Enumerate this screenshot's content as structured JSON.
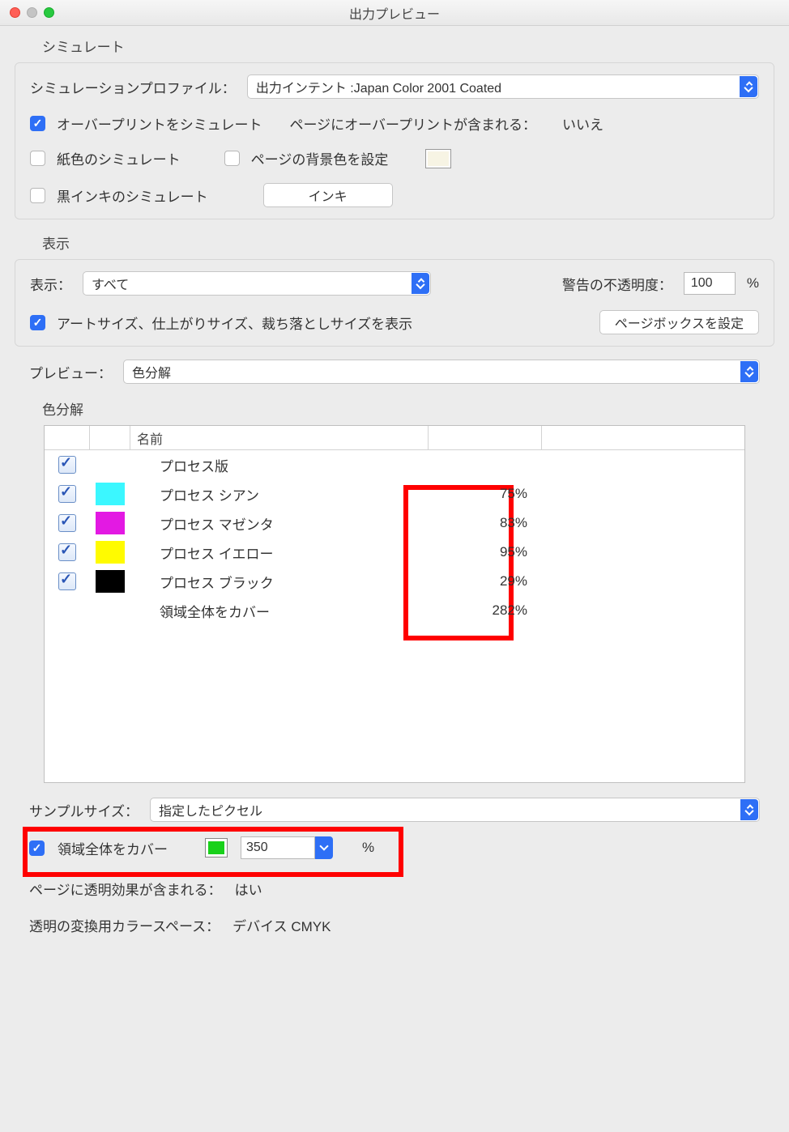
{
  "window": {
    "title": "出力プレビュー"
  },
  "simulate": {
    "section_label": "シミュレート",
    "profile_label": "シミュレーションプロファイル：",
    "profile_value": "出力インテント :Japan Color 2001 Coated",
    "overprint_checked": true,
    "overprint_label": "オーバープリントをシミュレート",
    "page_has_overprint_label": "ページにオーバープリントが含まれる：",
    "page_has_overprint_value": "いいえ",
    "paper_color_checked": false,
    "paper_color_label": "紙色のシミュレート",
    "set_bg_checked": false,
    "set_bg_label": "ページの背景色を設定",
    "black_ink_checked": false,
    "black_ink_label": "黒インキのシミュレート",
    "ink_button": "インキ"
  },
  "display": {
    "section_label": "表示",
    "show_label": "表示：",
    "show_value": "すべて",
    "opacity_label": "警告の不透明度：",
    "opacity_value": "100",
    "percent": "%",
    "artsize_checked": true,
    "artsize_label": "アートサイズ、仕上がりサイズ、裁ち落としサイズを表示",
    "pagebox_button": "ページボックスを設定"
  },
  "preview": {
    "label": "プレビュー：",
    "value": "色分解"
  },
  "separations": {
    "section_label": "色分解",
    "name_header": "名前",
    "rows": [
      {
        "name": "プロセス版",
        "value": "",
        "color": ""
      },
      {
        "name": "プロセス シアン",
        "value": "75%",
        "color": "#3bf7ff"
      },
      {
        "name": "プロセス マゼンタ",
        "value": "83%",
        "color": "#e319e3"
      },
      {
        "name": "プロセス イエロー",
        "value": "95%",
        "color": "#fffb00"
      },
      {
        "name": "プロセス ブラック",
        "value": "29%",
        "color": "#000000"
      },
      {
        "name": "領域全体をカバー",
        "value": "282%",
        "color": ""
      }
    ]
  },
  "sample": {
    "label": "サンプルサイズ：",
    "value": "指定したピクセル"
  },
  "coverage": {
    "checked": true,
    "label": "領域全体をカバー",
    "swatch_color": "#18d11a",
    "value": "350",
    "percent": "%"
  },
  "transparency": {
    "contains_label": "ページに透明効果が含まれる：",
    "contains_value": "はい",
    "colorspace_label": "透明の変換用カラースペース：",
    "colorspace_value": "デバイス CMYK"
  }
}
